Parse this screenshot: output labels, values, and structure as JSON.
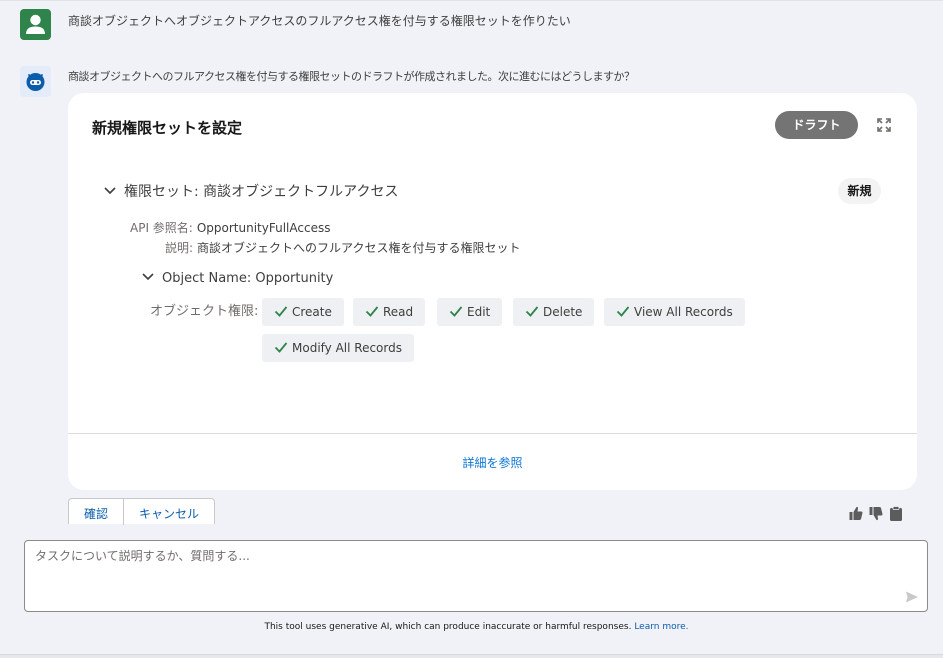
{
  "user_message": "商談オブジェクトへオブジェクトアクセスのフルアクセス権を付与する権限セットを作りたい",
  "bot_message": "商談オブジェクトへのフルアクセス権を付与する権限セットのドラフトが作成されました。次に進むにはどうしますか？",
  "card": {
    "title": "新規権限セットを設定",
    "status_badge": "ドラフト",
    "permission_set": {
      "label": "権限セット: 商談オブジェクトフルアクセス",
      "badge": "新規",
      "api_name_key": "API 参照名:",
      "api_name_value": "OpportunityFullAccess",
      "description_key": "説明:",
      "description_value": "商談オブジェクトへのフルアクセス権を付与する権限セット"
    },
    "object": {
      "label": "Object Name: Opportunity",
      "permissions_label": "オブジェクト権限:",
      "permissions": [
        "Create",
        "Read",
        "Edit",
        "Delete",
        "View All Records",
        "Modify All Records"
      ]
    },
    "details_link": "詳細を参照"
  },
  "actions": {
    "confirm": "確認",
    "cancel": "キャンセル"
  },
  "input": {
    "placeholder": "タスクについて説明するか、質問する..."
  },
  "disclaimer": {
    "text": "This tool uses generative AI, which can produce inaccurate or harmful responses.",
    "link": "Learn more."
  },
  "colors": {
    "user_avatar": "#2e844a",
    "bot_avatar": "#0b5cab",
    "check": "#2e844a",
    "link": "#0b74d4",
    "badge_draft": "#747474"
  },
  "icons": [
    "user-avatar-icon",
    "bot-avatar-icon",
    "expand-icon",
    "chevron-down-icon",
    "checkmark-icon",
    "thumbs-up-icon",
    "thumbs-down-icon",
    "clipboard-icon",
    "send-icon"
  ]
}
